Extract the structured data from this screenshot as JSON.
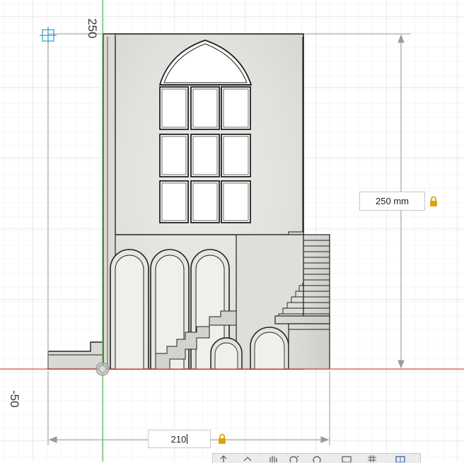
{
  "viewport": {
    "height_label": "250",
    "neg_label": "-50",
    "height_dimension": "250 mm",
    "width_dimension_input": "210"
  },
  "icons": {
    "origin": "origin-crosshair-icon",
    "lock_height": "lock-icon",
    "lock_width": "lock-icon",
    "pivot": "pivot-circle-icon"
  },
  "toolbar": {
    "buttons": [
      "orbit-icon",
      "pan-icon",
      "hand-icon",
      "zoom-icon",
      "fit-icon",
      "display-icon",
      "grid-icon",
      "viewport-icon"
    ]
  },
  "colors": {
    "grid_minor": "#e9e9e9",
    "grid_major": "#d4d4d4",
    "axis_x": "#e05555",
    "axis_y": "#5fbf5f",
    "dimension_line": "#9a9a9a",
    "lock": "#e0a20c",
    "model_stone": "#e4e3de"
  }
}
